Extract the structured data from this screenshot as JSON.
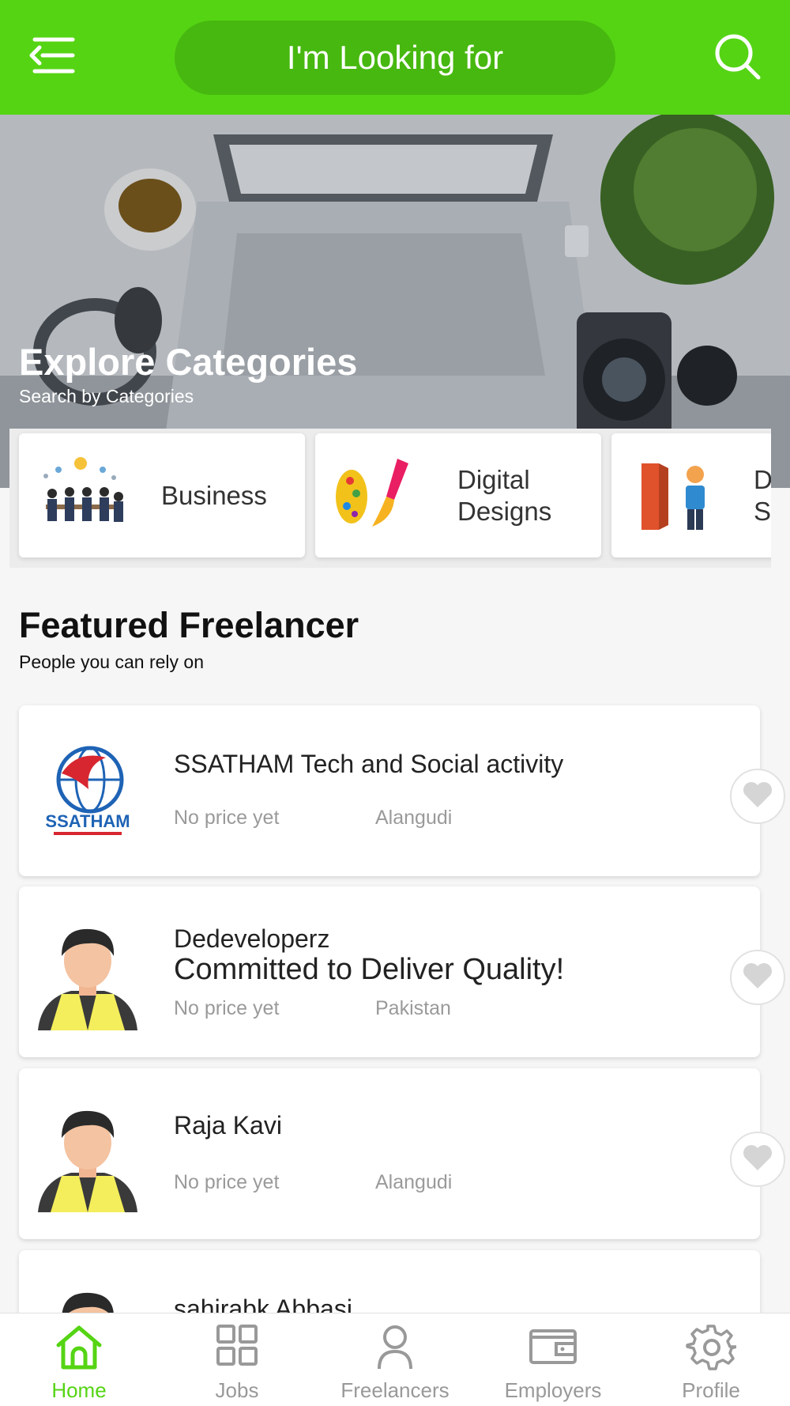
{
  "header": {
    "search_placeholder": "I'm Looking for",
    "icons": {
      "menu": "menu-arrow-icon",
      "search": "search-icon"
    }
  },
  "hero": {
    "title": "Explore Categories",
    "subtitle": "Search by Categories"
  },
  "categories": [
    {
      "label": "Business",
      "icon": "business-meeting-icon"
    },
    {
      "label": "Digital\nDesigns",
      "icon": "palette-brush-icon"
    },
    {
      "label": "D\nS",
      "icon": "door-person-icon"
    }
  ],
  "featured": {
    "title": "Featured Freelancer",
    "subtitle": "People you can rely on",
    "freelancers": [
      {
        "name": "SSATHAM Tech and Social activity",
        "tagline": "",
        "price": "No price yet",
        "location": "Alangudi",
        "avatar": "ssatham-logo"
      },
      {
        "name": "Dedeveloperz",
        "tagline": "Committed to Deliver Quality!",
        "price": "No price yet",
        "location": "Pakistan",
        "avatar": "person-avatar"
      },
      {
        "name": "Raja Kavi",
        "tagline": "",
        "price": "No price yet",
        "location": "Alangudi",
        "avatar": "person-avatar"
      },
      {
        "name": "sahirabk Abbasi",
        "tagline": "",
        "price": "",
        "location": "",
        "avatar": "person-avatar"
      }
    ]
  },
  "bottom_nav": {
    "items": [
      {
        "label": "Home",
        "icon": "home-icon",
        "active": true
      },
      {
        "label": "Jobs",
        "icon": "grid-icon",
        "active": false
      },
      {
        "label": "Freelancers",
        "icon": "person-icon",
        "active": false
      },
      {
        "label": "Employers",
        "icon": "wallet-icon",
        "active": false
      },
      {
        "label": "Profile",
        "icon": "gear-icon",
        "active": false
      }
    ]
  },
  "colors": {
    "accent": "#55d414",
    "accent_dark": "#47b80f"
  }
}
